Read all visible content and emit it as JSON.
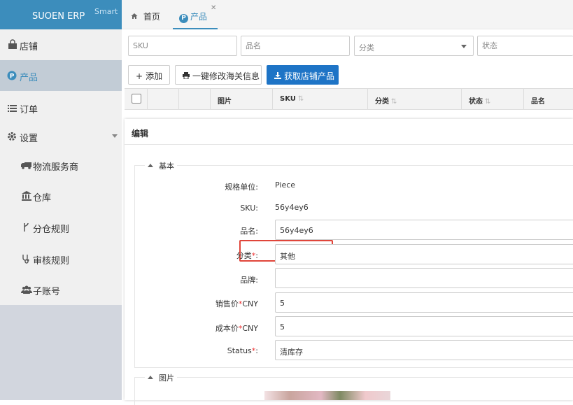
{
  "brand": {
    "name": "SUOEN ERP",
    "tag": "Smart"
  },
  "sidebar": {
    "items": [
      {
        "label": "店铺",
        "icon": "shopping-bag-icon"
      },
      {
        "label": "产品",
        "icon": "product-p-icon"
      },
      {
        "label": "订单",
        "icon": "list-icon"
      },
      {
        "label": "设置",
        "icon": "gear-icon"
      },
      {
        "label": "物流服务商",
        "icon": "truck-icon"
      },
      {
        "label": "仓库",
        "icon": "bank-icon"
      },
      {
        "label": "分仓规则",
        "icon": "branch-icon"
      },
      {
        "label": "审核规则",
        "icon": "stethoscope-icon"
      },
      {
        "label": "子账号",
        "icon": "users-icon"
      }
    ]
  },
  "tabs": [
    {
      "label": "首页",
      "icon": "home-icon"
    },
    {
      "label": "产品",
      "icon": "product-p-icon"
    }
  ],
  "filters": {
    "sku": "SKU",
    "name": "品名",
    "category": "分类",
    "status": "状态"
  },
  "toolbar": {
    "add": "添加",
    "batch_customs": "一键修改海关信息",
    "fetch": "获取店铺产品"
  },
  "table": {
    "columns": [
      "图片",
      "SKU",
      "分类",
      "状态",
      "品名"
    ]
  },
  "editor": {
    "title": "编辑",
    "section_basic": "基本",
    "section_image": "图片",
    "fields": {
      "unit": {
        "label": "规格单位:",
        "value": "Piece"
      },
      "sku": {
        "label": "SKU:",
        "value": "56y4ey6"
      },
      "name": {
        "label": "品名:",
        "value": "56y4ey6"
      },
      "category": {
        "label": "分类",
        "value": "其他"
      },
      "brand": {
        "label": "品牌:",
        "value": ""
      },
      "price": {
        "label_a": "销售价",
        "label_b": "CNY",
        "value": "5"
      },
      "cost": {
        "label_a": "成本价",
        "label_b": "CNY",
        "value": "5"
      },
      "status": {
        "label": "Status",
        "value": "清库存"
      }
    },
    "req": "*",
    "colon": ":"
  },
  "colors": {
    "brand": "#3c8dbc",
    "primary": "#1e74c6",
    "highlight": "#e0453a"
  }
}
